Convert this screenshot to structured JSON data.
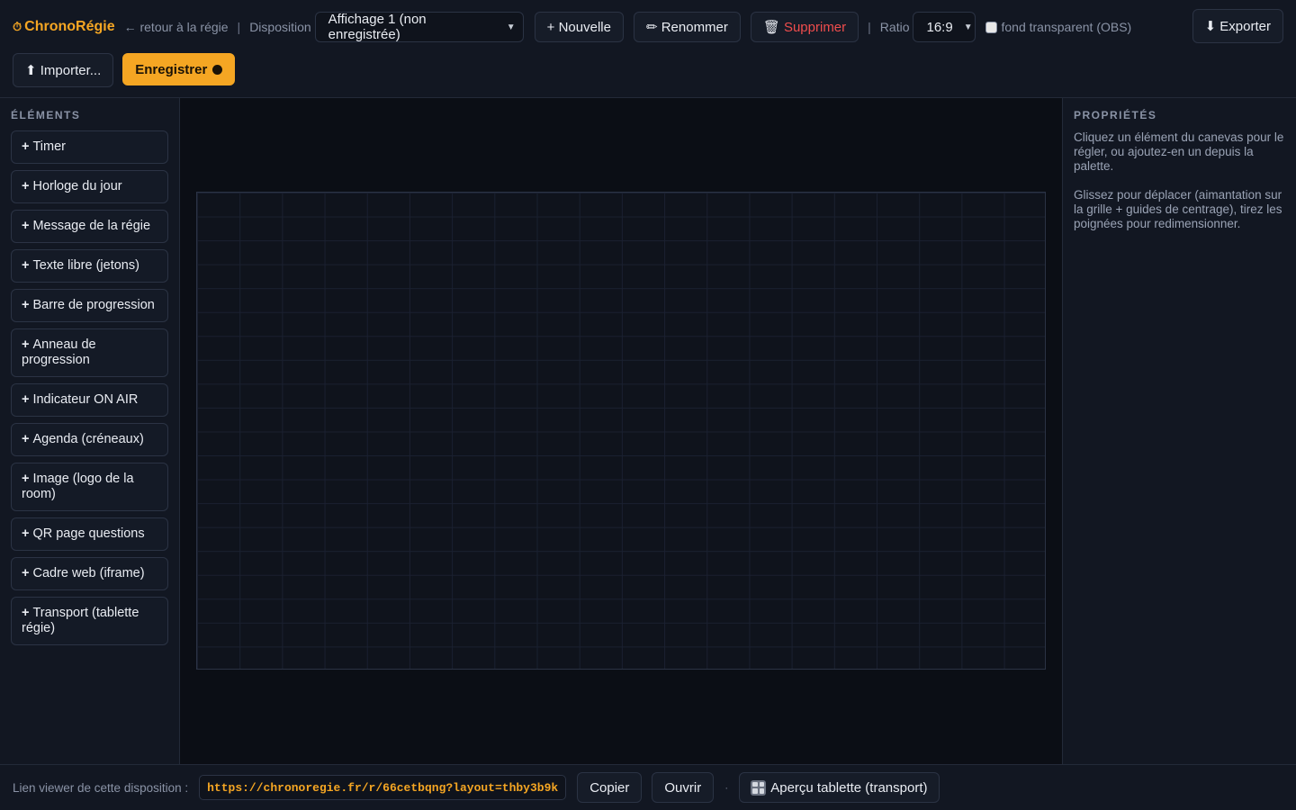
{
  "header": {
    "brand_icon": "⏱",
    "brand": "ChronoRégie",
    "back": "← retour à la régie",
    "sep1": "|",
    "disposition_label": "Disposition",
    "layout_select_value": "Affichage 1 (non enregistrée)",
    "new": "+ Nouvelle",
    "rename": "✏ Renommer",
    "delete_icon": "🗑",
    "delete": "Supprimer",
    "sep2": "|",
    "ratio_label": "Ratio",
    "ratio_value": "16:9",
    "transparent_label": "fond transparent (OBS)",
    "export": "⬇ Exporter",
    "import": "⬆ Importer...",
    "save": "Enregistrer"
  },
  "sidebar": {
    "title": "ÉLÉMENTS",
    "items": [
      {
        "label": "Timer"
      },
      {
        "label": "Horloge du jour"
      },
      {
        "label": "Message de la régie"
      },
      {
        "label": "Texte libre (jetons)"
      },
      {
        "label": "Barre de progression"
      },
      {
        "label": "Anneau de progression"
      },
      {
        "label": "Indicateur ON AIR"
      },
      {
        "label": "Agenda (créneaux)"
      },
      {
        "label": "Image (logo de la room)"
      },
      {
        "label": "QR page questions"
      },
      {
        "label": "Cadre web (iframe)"
      },
      {
        "label": "Transport (tablette régie)"
      }
    ]
  },
  "properties": {
    "title": "PROPRIÉTÉS",
    "hint1": "Cliquez un élément du canevas pour le régler, ou ajoutez-en un depuis la palette.",
    "hint2": "Glissez pour déplacer (aimantation sur la grille + guides de centrage), tirez les poignées pour redimensionner."
  },
  "footer": {
    "label": "Lien viewer de cette disposition :",
    "url": "https://chronoregie.fr/r/66cetbqng?layout=thby3b9k",
    "copy": "Copier",
    "open": "Ouvrir",
    "sep": "·",
    "tablet": "Aperçu tablette (transport)"
  },
  "colors": {
    "accent": "#f5a623",
    "danger": "#ef4d4d",
    "background": "#0d111a"
  }
}
